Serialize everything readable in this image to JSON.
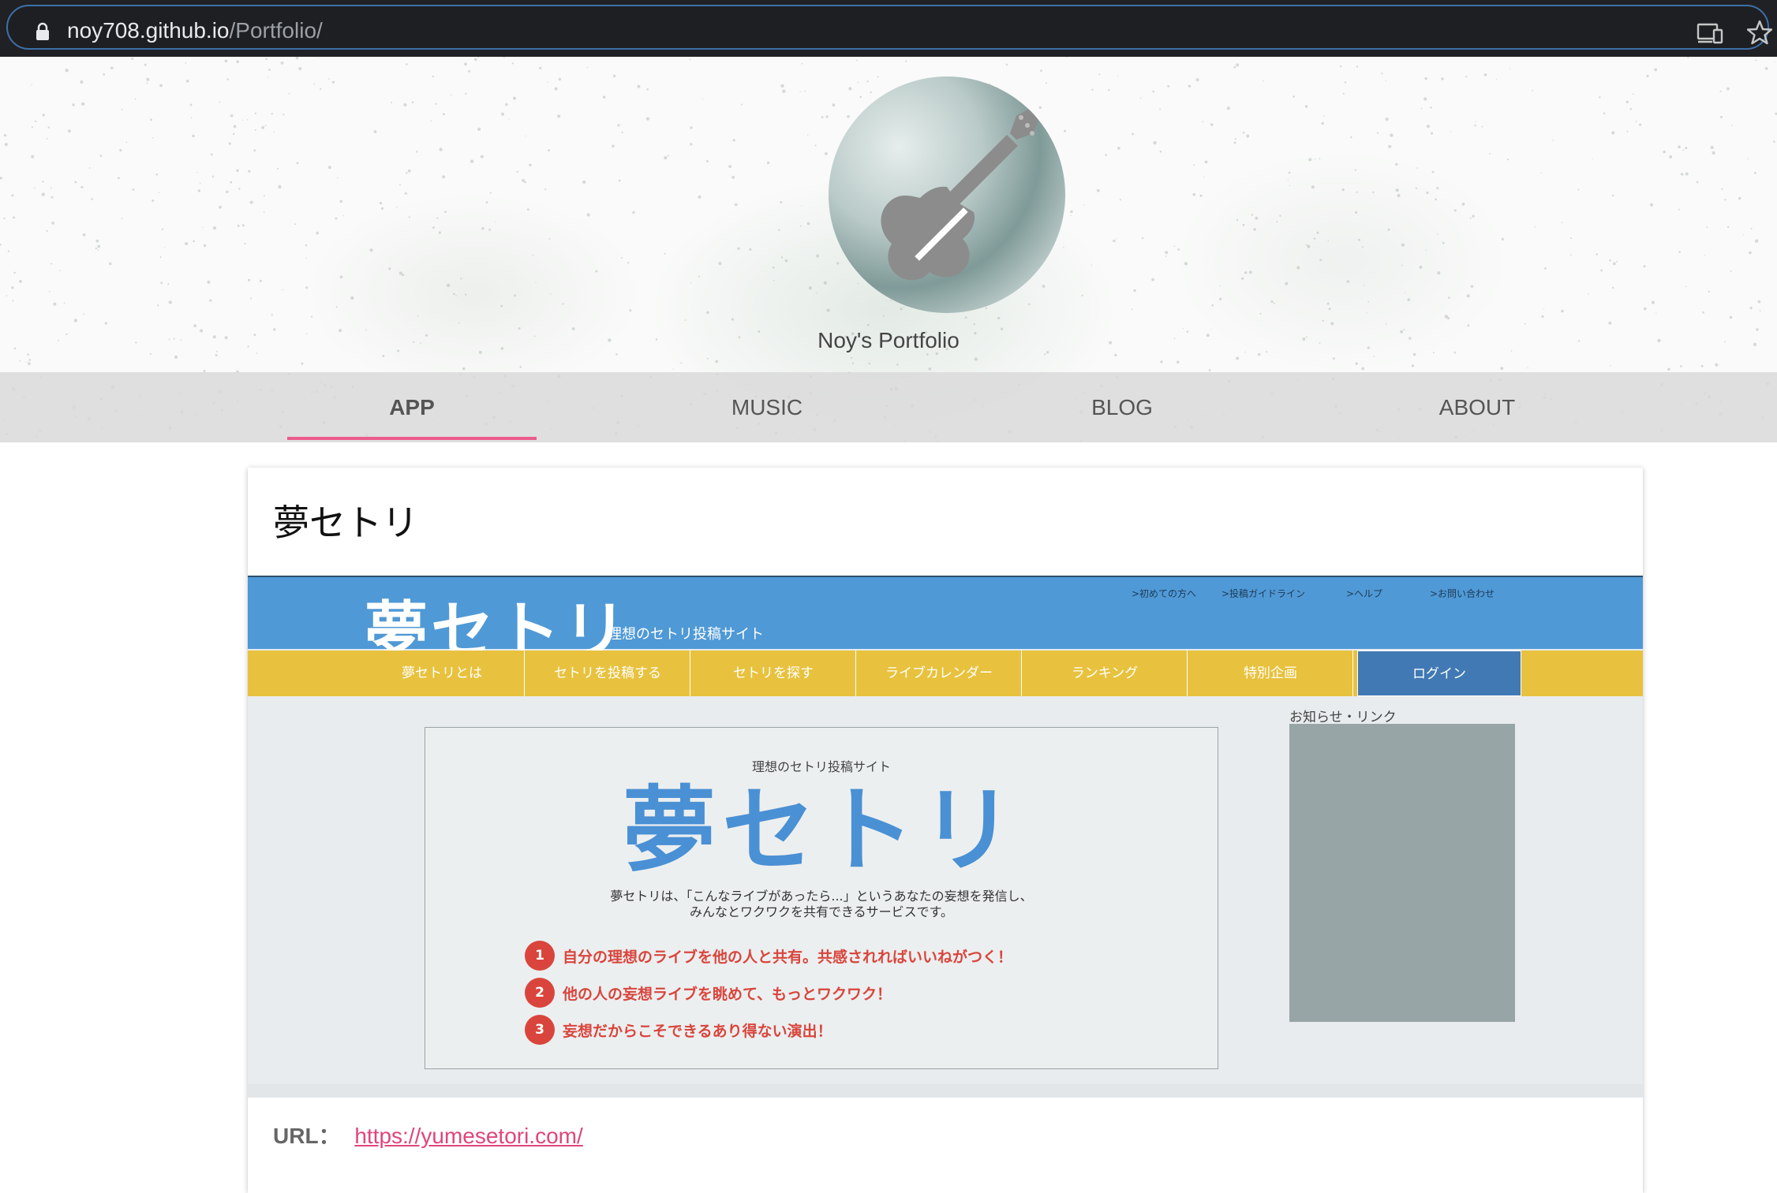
{
  "browser": {
    "url_host": "noy708.github.io",
    "url_path": "/Portfolio/"
  },
  "hero": {
    "site_name": "Noy's Portfolio"
  },
  "nav": {
    "tabs": [
      {
        "label": "APP",
        "active": true
      },
      {
        "label": "MUSIC",
        "active": false
      },
      {
        "label": "BLOG",
        "active": false
      },
      {
        "label": "ABOUT",
        "active": false
      }
    ]
  },
  "card": {
    "title": "夢セトリ",
    "url_label": "URL：",
    "url_link": "https://yumesetori.com/"
  },
  "preview": {
    "logo": "夢セトリ",
    "tagline": "理想のセトリ投稿サイト",
    "top_links": [
      ">初めての方へ",
      ">投稿ガイドライン",
      ">ヘルプ",
      ">お問い合わせ"
    ],
    "menu": [
      "夢セトリとは",
      "セトリを投稿する",
      "セトリを探す",
      "ライブカレンダー",
      "ランキング",
      "特別企画",
      "ログイン"
    ],
    "main_sub": "理想のセトリ投稿サイト",
    "main_title": "夢セトリ",
    "desc_line1": "夢セトリは、「こんなライブがあったら...」というあなたの妄想を発信し、",
    "desc_line2": "みんなとワクワクを共有できるサービスです。",
    "points": [
      {
        "num": "1",
        "text": "自分の理想のライブを他の人と共有。共感されればいいねがつく！"
      },
      {
        "num": "2",
        "text": "他の人の妄想ライブを眺めて、もっとワクワク！"
      },
      {
        "num": "3",
        "text": "妄想だからこそできるあり得ない演出！"
      }
    ],
    "side_label": "お知らせ・リンク"
  },
  "colors": {
    "accent_pink": "#ec5c8c",
    "preview_blue": "#4f99d6",
    "preview_yellow": "#e8c23e",
    "point_red": "#d9453c"
  },
  "icons": [
    "lock-icon",
    "cast-icon",
    "star-icon",
    "guitar-icon"
  ]
}
